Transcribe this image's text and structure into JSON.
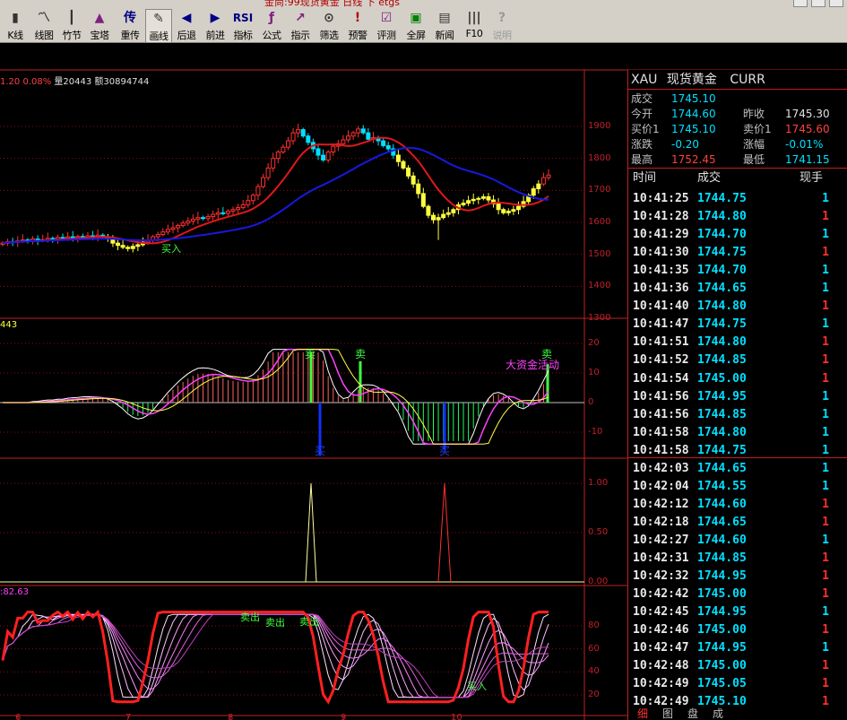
{
  "window": {
    "title": "金尚:99现货黄金 日线 下 etgs"
  },
  "toolbar": [
    {
      "label": "K线",
      "icon": "candlestick-icon",
      "color": "#333"
    },
    {
      "label": "线图",
      "icon": "line-chart-icon",
      "color": "#333"
    },
    {
      "label": "竹节",
      "icon": "bamboo-chart-icon",
      "color": "#333"
    },
    {
      "label": "宝塔",
      "icon": "tower-chart-icon",
      "color": "#802080"
    },
    {
      "label": "重传",
      "icon": "reload-icon",
      "color": "#000080"
    },
    {
      "label": "画线",
      "icon": "draw-line-icon",
      "color": "#333"
    },
    {
      "label": "后退",
      "icon": "back-arrow-icon",
      "color": "#000080"
    },
    {
      "label": "前进",
      "icon": "forward-arrow-icon",
      "color": "#000080"
    },
    {
      "label": "指标",
      "icon": "rsi-icon",
      "color": "#000080"
    },
    {
      "label": "公式",
      "icon": "formula-icon",
      "color": "#802080"
    },
    {
      "label": "指示",
      "icon": "indicator-icon",
      "color": "#802080"
    },
    {
      "label": "筛选",
      "icon": "binoculars-icon",
      "color": "#333"
    },
    {
      "label": "预警",
      "icon": "alarm-icon",
      "color": "#b00000"
    },
    {
      "label": "评测",
      "icon": "evaluate-icon",
      "color": "#802080"
    },
    {
      "label": "全屏",
      "icon": "fullscreen-icon",
      "color": "#008000"
    },
    {
      "label": "新闻",
      "icon": "news-icon",
      "color": "#333"
    },
    {
      "label": "F10",
      "icon": "books-icon",
      "color": "#333"
    },
    {
      "label": "说明",
      "icon": "help-icon",
      "color": "#999"
    }
  ],
  "status_line": {
    "change": "1.20 0.08%",
    "volume": "量20443",
    "amount": "额30894744"
  },
  "panels": {
    "indicator1_value": "443",
    "indicator3_value": ":82.63"
  },
  "axes": {
    "price": [
      "1900",
      "1800",
      "1700",
      "1600",
      "1500",
      "1400",
      "1300"
    ],
    "macd": [
      "20",
      "10",
      "0",
      "-10"
    ],
    "signal": [
      "1.00",
      "0.50",
      "0.00"
    ],
    "kdj": [
      "80",
      "60",
      "40",
      "20"
    ],
    "x": [
      "6",
      "7",
      "8",
      "9",
      "10"
    ]
  },
  "annotations": {
    "buy_main": "买入",
    "sell1": "卖",
    "sell2": "卖",
    "sell3": "卖",
    "buy1": "买",
    "buy2": "买",
    "big_money": "大资金活动",
    "sell_out1": "卖出",
    "sell_out2": "卖出",
    "sell_out3": "卖出",
    "buy_kdj": "买入"
  },
  "quote": {
    "code": "XAU",
    "name": "现货黄金",
    "currency": "CURR",
    "last_label": "成交",
    "last": "1745.10",
    "open_label": "今开",
    "open": "1744.60",
    "prev_label": "昨收",
    "prev": "1745.30",
    "bid_label": "买价1",
    "bid": "1745.10",
    "ask_label": "卖价1",
    "ask": "1745.60",
    "chg_label": "涨跌",
    "chg": "-0.20",
    "chgpct_label": "涨幅",
    "chgpct": "-0.01%",
    "high_label": "最高",
    "high": "1752.45",
    "low_label": "最低",
    "low": "1741.15"
  },
  "ticks_header": {
    "time": "时间",
    "price": "成交",
    "vol": "现手"
  },
  "ticks": [
    {
      "time": "10:41:25",
      "price": "1744.75",
      "vol": "1",
      "side": "buy"
    },
    {
      "time": "10:41:28",
      "price": "1744.80",
      "vol": "1",
      "side": "sell"
    },
    {
      "time": "10:41:29",
      "price": "1744.70",
      "vol": "1",
      "side": "buy"
    },
    {
      "time": "10:41:30",
      "price": "1744.75",
      "vol": "1",
      "side": "sell"
    },
    {
      "time": "10:41:35",
      "price": "1744.70",
      "vol": "1",
      "side": "buy"
    },
    {
      "time": "10:41:36",
      "price": "1744.65",
      "vol": "1",
      "side": "buy"
    },
    {
      "time": "10:41:40",
      "price": "1744.80",
      "vol": "1",
      "side": "sell"
    },
    {
      "time": "10:41:47",
      "price": "1744.75",
      "vol": "1",
      "side": "buy"
    },
    {
      "time": "10:41:51",
      "price": "1744.80",
      "vol": "1",
      "side": "sell"
    },
    {
      "time": "10:41:52",
      "price": "1744.85",
      "vol": "1",
      "side": "sell"
    },
    {
      "time": "10:41:54",
      "price": "1745.00",
      "vol": "1",
      "side": "sell"
    },
    {
      "time": "10:41:56",
      "price": "1744.95",
      "vol": "1",
      "side": "buy"
    },
    {
      "time": "10:41:56",
      "price": "1744.85",
      "vol": "1",
      "side": "buy"
    },
    {
      "time": "10:41:58",
      "price": "1744.80",
      "vol": "1",
      "side": "buy"
    },
    {
      "time": "10:41:58",
      "price": "1744.75",
      "vol": "1",
      "side": "buy"
    },
    {
      "time": "10:42:03",
      "price": "1744.65",
      "vol": "1",
      "side": "buy"
    },
    {
      "time": "10:42:04",
      "price": "1744.55",
      "vol": "1",
      "side": "buy"
    },
    {
      "time": "10:42:12",
      "price": "1744.60",
      "vol": "1",
      "side": "sell"
    },
    {
      "time": "10:42:18",
      "price": "1744.65",
      "vol": "1",
      "side": "sell"
    },
    {
      "time": "10:42:27",
      "price": "1744.60",
      "vol": "1",
      "side": "buy"
    },
    {
      "time": "10:42:31",
      "price": "1744.85",
      "vol": "1",
      "side": "sell"
    },
    {
      "time": "10:42:32",
      "price": "1744.95",
      "vol": "1",
      "side": "sell"
    },
    {
      "time": "10:42:42",
      "price": "1745.00",
      "vol": "1",
      "side": "sell"
    },
    {
      "time": "10:42:45",
      "price": "1744.95",
      "vol": "1",
      "side": "buy"
    },
    {
      "time": "10:42:46",
      "price": "1745.00",
      "vol": "1",
      "side": "sell"
    },
    {
      "time": "10:42:47",
      "price": "1744.95",
      "vol": "1",
      "side": "buy"
    },
    {
      "time": "10:42:48",
      "price": "1745.00",
      "vol": "1",
      "side": "sell"
    },
    {
      "time": "10:42:49",
      "price": "1745.05",
      "vol": "1",
      "side": "sell"
    },
    {
      "time": "10:42:49",
      "price": "1745.10",
      "vol": "1",
      "side": "sell"
    }
  ],
  "bottom_tabs": [
    "细",
    "图",
    "盘",
    "成"
  ],
  "colors": {
    "up": "#ff3030",
    "down": "#00e0ff",
    "yellow_candle": "#ffff40",
    "ma_red": "#e01818",
    "ma_blue": "#1818e0",
    "grid": "#801010"
  }
}
